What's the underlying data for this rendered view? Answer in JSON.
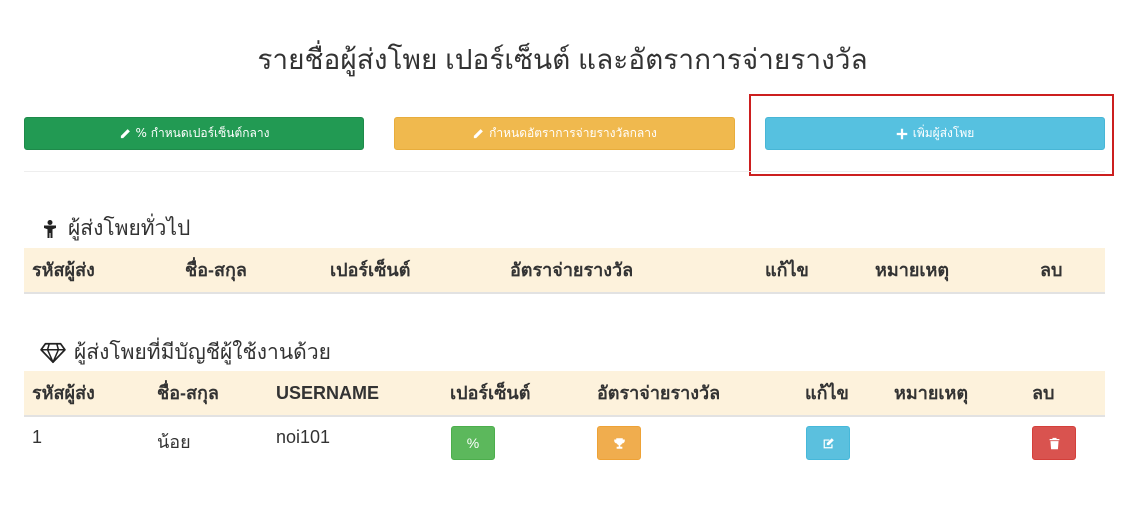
{
  "page": {
    "title": "รายชื่อผู้ส่งโพย เปอร์เซ็นต์ และอัตราการจ่ายรางวัล"
  },
  "toolbar": {
    "set_percent_label": "% กำหนดเปอร์เซ็นต์กลาง",
    "set_rate_label": "กำหนดอัตราการจ่ายรางวัลกลาง",
    "add_sender_label": "เพิ่มผู้ส่งโพย"
  },
  "section_general": {
    "title": "ผู้ส่งโพยทั่วไป",
    "columns": [
      "รหัสผู้ส่ง",
      "ชื่อ-สกุล",
      "เปอร์เซ็นต์",
      "อัตราจ่ายรางวัล",
      "แก้ไข",
      "หมายเหตุ",
      "ลบ"
    ]
  },
  "section_account": {
    "title": "ผู้ส่งโพยที่มีบัญชีผู้ใช้งานด้วย",
    "columns": [
      "รหัสผู้ส่ง",
      "ชื่อ-สกุล",
      "USERNAME",
      "เปอร์เซ็นต์",
      "อัตราจ่ายรางวัล",
      "แก้ไข",
      "หมายเหตุ",
      "ลบ"
    ],
    "rows": [
      {
        "id": "1",
        "name": "น้อย",
        "username": "noi101",
        "percent_btn": "%",
        "note": ""
      }
    ]
  },
  "colors": {
    "green": "#229a53",
    "yellow": "#f0b94e",
    "cyan": "#56c1e0",
    "red": "#d9534f",
    "header_bg": "#fdf2dc",
    "highlight": "#cc1f1f"
  },
  "icons": {
    "set_percent": "pencil-icon",
    "set_rate": "pencil-icon",
    "add_sender": "plus-icon",
    "section_general": "person-icon",
    "section_account": "diamond-icon",
    "row_rate": "trophy-icon",
    "row_edit": "edit-icon",
    "row_delete": "trash-icon"
  }
}
